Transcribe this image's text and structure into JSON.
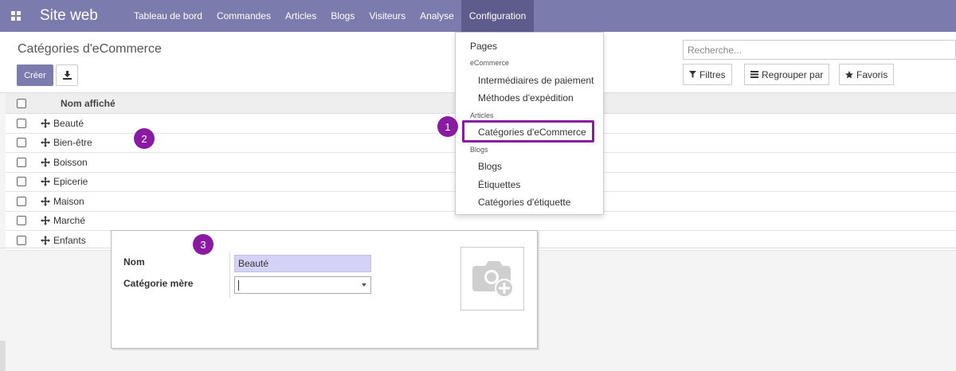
{
  "navbar": {
    "app_title": "Site web",
    "menu": [
      "Tableau de bord",
      "Commandes",
      "Articles",
      "Blogs",
      "Visiteurs",
      "Analyse",
      "Configuration"
    ],
    "bg_color": "#7c7bad",
    "active_bg_color": "#5d5c8d"
  },
  "control_panel": {
    "breadcrumb": "Catégories d'eCommerce",
    "create_label": "Créer",
    "search_placeholder": "Recherche...",
    "filters_label": "Filtres",
    "group_by_label": "Regrouper par",
    "favorites_label": "Favoris"
  },
  "list": {
    "column_header": "Nom affiché",
    "rows": [
      "Beauté",
      "Bien-être",
      "Boisson",
      "Epicerie",
      "Maison",
      "Marché",
      "Enfants"
    ]
  },
  "dropdown": {
    "pages": "Pages",
    "ecommerce_header": "eCommerce",
    "payment": "Intermédiaires de paiement",
    "shipping": "Méthodes d'expédition",
    "articles_header": "Articles",
    "categories": "Catégories d'eCommerce",
    "blogs_header": "Blogs",
    "blogs": "Blogs",
    "tags": "Étiquettes",
    "tag_categories": "Catégories d'étiquette"
  },
  "form": {
    "name_label": "Nom",
    "name_value": "Beauté",
    "parent_label": "Catégorie mère",
    "parent_value": ""
  },
  "badges": {
    "b1": "1",
    "b2": "2",
    "b3": "3"
  },
  "colors": {
    "accent": "#7c7bad",
    "highlight": "#8a1aa1",
    "input_highlight": "#d4d3f7"
  }
}
